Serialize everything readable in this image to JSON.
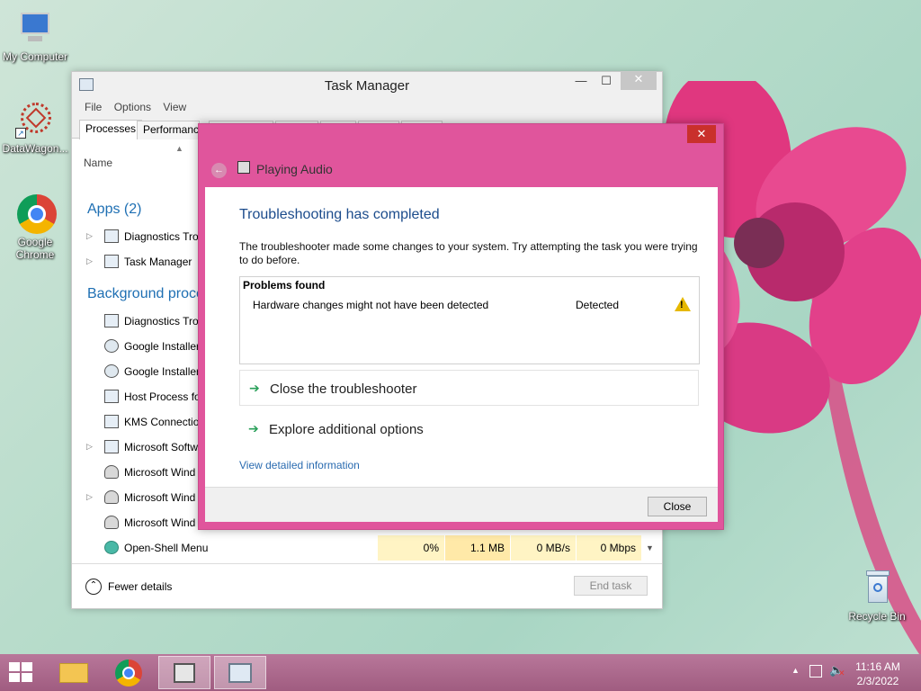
{
  "desktop": {
    "icons": [
      {
        "label": "My Computer",
        "icon": "computer-icon"
      },
      {
        "label": "DataWagon...",
        "icon": "datawagon-icon"
      },
      {
        "label": "Google Chrome",
        "icon": "chrome-icon"
      },
      {
        "label": "Recycle Bin",
        "icon": "recycle-bin-icon"
      }
    ]
  },
  "task_manager": {
    "title": "Task Manager",
    "window_buttons": {
      "minimize": "—",
      "maximize": "☐",
      "close": "✕"
    },
    "menu": [
      "File",
      "Options",
      "View"
    ],
    "tabs": [
      "Processes",
      "Performanc"
    ],
    "column_name": "Name",
    "groups": {
      "apps": "Apps (2)",
      "background": "Background proce"
    },
    "apps": [
      {
        "name": "Diagnostics Tro",
        "expandable": true
      },
      {
        "name": "Task Manager",
        "expandable": true
      }
    ],
    "background": [
      {
        "name": "Diagnostics Tro",
        "expandable": false
      },
      {
        "name": "Google Installer",
        "expandable": false
      },
      {
        "name": "Google Installer",
        "expandable": false
      },
      {
        "name": "Host Process fo",
        "expandable": false
      },
      {
        "name": "KMS Connectio",
        "expandable": false
      },
      {
        "name": "Microsoft Softw",
        "expandable": true
      },
      {
        "name": "Microsoft Wind",
        "expandable": false
      },
      {
        "name": "Microsoft Wind",
        "expandable": true
      },
      {
        "name": "Microsoft Wind",
        "expandable": false
      },
      {
        "name": "Open-Shell Menu",
        "expandable": false,
        "cpu": "0%",
        "memory": "1.1 MB",
        "disk": "0 MB/s",
        "network": "0 Mbps"
      }
    ],
    "fewer_details": "Fewer details",
    "end_task": "End task"
  },
  "dialog": {
    "title": "Playing Audio",
    "close_glyph": "✕",
    "heading": "Troubleshooting has completed",
    "description": "The troubleshooter made some changes to your system. Try attempting the task you were trying to do before.",
    "problems_header": "Problems found",
    "problems": [
      {
        "issue": "Hardware changes might not have been detected",
        "status": "Detected"
      }
    ],
    "options": [
      "Close the troubleshooter",
      "Explore additional options"
    ],
    "view_details": "View detailed information",
    "close_button": "Close"
  },
  "taskbar": {
    "time": "11:16 AM",
    "date": "2/3/2022",
    "pinned": [
      "file-explorer-icon",
      "chrome-icon",
      "troubleshooter-icon",
      "task-manager-icon"
    ]
  },
  "colors": {
    "dialog_frame": "#e0559c",
    "taskbar": "#b06a8c",
    "link": "#2a6bb0",
    "heading": "#1c4c8c"
  }
}
